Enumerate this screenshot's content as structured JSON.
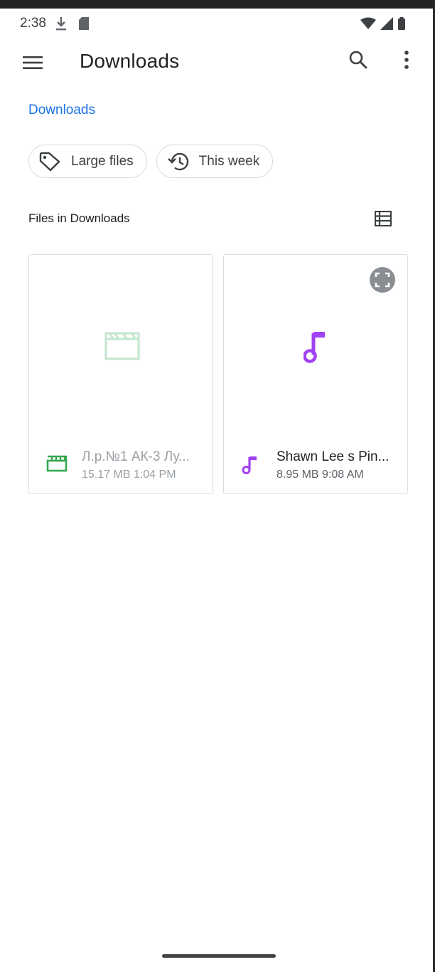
{
  "status_bar": {
    "time": "2:38",
    "icons": [
      "download-icon",
      "sd-card-icon",
      "wifi-icon",
      "signal-icon",
      "battery-icon"
    ]
  },
  "app_bar": {
    "title": "Downloads",
    "icons": [
      "menu-icon",
      "search-icon",
      "more-vert-icon"
    ]
  },
  "breadcrumb": {
    "label": "Downloads"
  },
  "chips": [
    {
      "label": "Large files",
      "icon": "tag-icon"
    },
    {
      "label": "This week",
      "icon": "history-icon"
    }
  ],
  "section": {
    "title": "Files in Downloads",
    "layout_icon": "list-view-icon"
  },
  "files": [
    {
      "name": "Л.р.№1 АК-3 Лу...",
      "size": "15.17 MB",
      "time": "1:04 PM",
      "type": "video",
      "icon": "movie-icon",
      "color": "#34a853"
    },
    {
      "name": "Shawn Lee s Pin...",
      "size": "8.95 MB",
      "time": "9:08 AM",
      "type": "audio",
      "icon": "music-note-icon",
      "color": "#a142f4"
    }
  ],
  "colors": {
    "accent": "#1a73e8",
    "video": "#34a853",
    "audio": "#a142f4"
  }
}
